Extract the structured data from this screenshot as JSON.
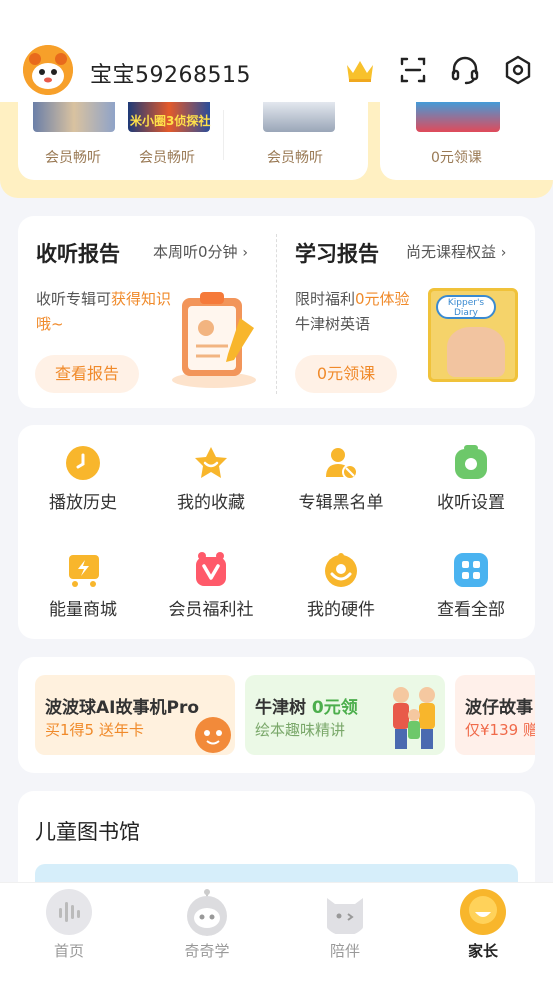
{
  "header": {
    "username": "宝宝59268515",
    "icons": [
      "crown-icon",
      "scan-icon",
      "headset-icon",
      "settings-icon"
    ]
  },
  "member_strip": {
    "items": [
      {
        "label": "会员畅听"
      },
      {
        "label": "会员畅听"
      },
      {
        "label": "会员畅听"
      },
      {
        "label": "0元领课"
      }
    ],
    "thumb_text": "米小圈3侦探社"
  },
  "reports": {
    "listen": {
      "title": "收听报告",
      "link": "本周听0分钟",
      "text_prefix": "收听专辑可",
      "text_highlight": "获得知识哦~",
      "button": "查看报告"
    },
    "study": {
      "title": "学习报告",
      "link": "尚无课程权益",
      "line1_prefix": "限时福利",
      "line1_highlight": "0元体验",
      "line2": "牛津树英语",
      "button": "0元领课",
      "book_title": "Kipper's Diary"
    }
  },
  "grid": {
    "items": [
      {
        "label": "播放历史",
        "icon": "history-icon"
      },
      {
        "label": "我的收藏",
        "icon": "favorite-icon"
      },
      {
        "label": "专辑黑名单",
        "icon": "blacklist-icon"
      },
      {
        "label": "收听设置",
        "icon": "listen-settings-icon"
      },
      {
        "label": "能量商城",
        "icon": "shop-icon"
      },
      {
        "label": "会员福利社",
        "icon": "member-welfare-icon"
      },
      {
        "label": "我的硬件",
        "icon": "hardware-icon"
      },
      {
        "label": "查看全部",
        "icon": "all-apps-icon"
      }
    ]
  },
  "promos": [
    {
      "title": "波波球AI故事机Pro",
      "subtitle": "买1得5 送年卡"
    },
    {
      "title_prefix": "牛津树 ",
      "title_highlight": "0元领",
      "subtitle": "绘本趣味精讲"
    },
    {
      "title": "波仔故事",
      "subtitle": "仅¥139 赠"
    }
  ],
  "library": {
    "title": "儿童图书馆"
  },
  "bottom_nav": {
    "items": [
      {
        "label": "首页"
      },
      {
        "label": "奇奇学"
      },
      {
        "label": "陪伴"
      },
      {
        "label": "家长"
      }
    ],
    "active_index": 3
  },
  "colors": {
    "accent_orange": "#f08a2a",
    "member_band": "#fff0c2",
    "brand_yellow": "#f8b62c"
  }
}
